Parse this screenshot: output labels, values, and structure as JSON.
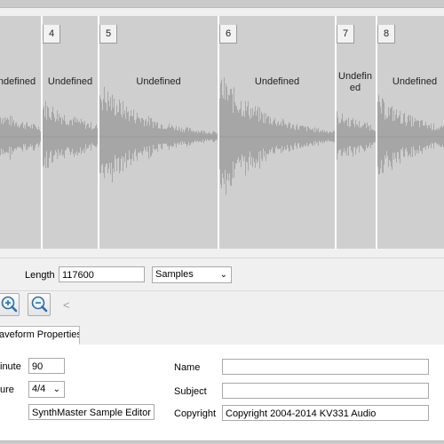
{
  "regions": [
    {
      "number": "",
      "label": "ndefined"
    },
    {
      "number": "4",
      "label": "Undefined"
    },
    {
      "number": "5",
      "label": "Undefined"
    },
    {
      "number": "6",
      "label": "Undefined"
    },
    {
      "number": "7",
      "label": "Undefined"
    },
    {
      "number": "8",
      "label": "Undefined"
    }
  ],
  "length": {
    "label": "Length",
    "value": "117600",
    "unit_selected": "Samples"
  },
  "tabs": [
    {
      "label": "aveform Properties",
      "active": true
    }
  ],
  "properties": {
    "bpm_label": "inute",
    "bpm_value": "90",
    "signature_label": "ure",
    "signature_value": "4/4",
    "software_value": "SynthMaster Sample Editor",
    "name_label": "Name",
    "name_value": "",
    "subject_label": "Subject",
    "subject_value": "",
    "copyright_label": "Copyright",
    "copyright_value": "Copyright 2004-2014 KV331 Audio"
  },
  "icons": {
    "zoom_in": "zoom-in-icon",
    "zoom_out": "zoom-out-icon",
    "scroll_left": "chevron-left-icon"
  },
  "glyphs": {
    "chevron_left": "<",
    "dropdown": "⌄"
  },
  "colors": {
    "waveform": "#a6a6a6",
    "region_bg": "#cfcfcf",
    "divider": "#ffffff"
  }
}
